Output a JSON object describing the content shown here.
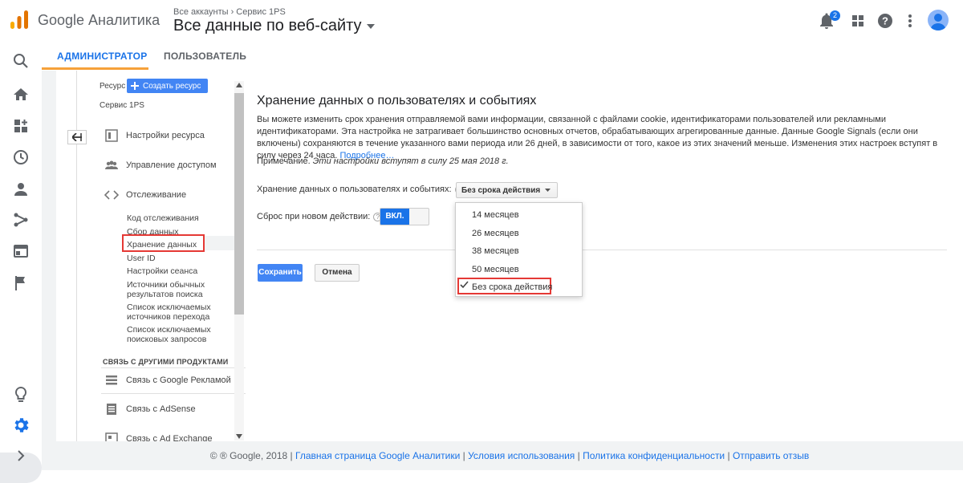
{
  "header": {
    "brand": "Google Аналитика",
    "breadcrumb": "Все аккаунты › Сервис 1PS",
    "view_title": "Все данные по веб-сайту",
    "notification_count": "2",
    "icons": [
      "bell-icon",
      "apps-icon",
      "help-icon",
      "more-vert-icon",
      "avatar"
    ]
  },
  "rail": {
    "icons": [
      "search-icon",
      "home-icon",
      "customize-icon",
      "clock-icon",
      "person-icon",
      "share-icon",
      "window-icon",
      "flag-icon",
      "lightbulb-icon",
      "gear-icon",
      "chevron-right-icon"
    ]
  },
  "tabs": {
    "admin": "АДМИНИСТРАТОР",
    "user": "ПОЛЬЗОВАТЕЛЬ"
  },
  "resource": {
    "label": "Ресурс",
    "create_button": "Создать ресурс",
    "name": "Сервис 1PS",
    "sections": [
      {
        "label": "Настройки ресурса",
        "icon": "settings-page-icon"
      },
      {
        "label": "Управление доступом",
        "icon": "people-icon"
      },
      {
        "label": "Отслеживание",
        "icon": "code-icon"
      }
    ],
    "sub_items": [
      "Код отслеживания",
      "Сбор данных",
      "Хранение данных",
      "User ID",
      "Настройки сеанса",
      "Источники обычных результатов поиска",
      "Список исключаемых источников перехода",
      "Список исключаемых поисковых запросов"
    ],
    "selected_sub_item": "Хранение данных",
    "other_products_header": "СВЯЗЬ С ДРУГИМИ ПРОДУКТАМИ",
    "links": [
      {
        "label": "Связь с Google Рекламой",
        "icon": "ads-link-icon"
      },
      {
        "label": "Связь с AdSense",
        "icon": "adsense-link-icon"
      },
      {
        "label": "Связь с Ad Exchange",
        "icon": "ad-exchange-link-icon"
      }
    ]
  },
  "main": {
    "title": "Хранение данных о пользователях и событиях",
    "description": "Вы можете изменить срок хранения отправляемой вами информации, связанной с файлами cookie, идентификаторами пользователей или рекламными идентификаторами. Эта настройка не затрагивает большинство основных отчетов, обрабатывающих агрегированные данные. Данные Google Signals (если они включены) сохраняются в течение указанного вами периода или 26 дней, в зависимости от того, какое из этих значений меньше. Изменения этих настроек вступят в силу через 24 часа.",
    "learn_more": "Подробнее…",
    "note_label": "Примечание.",
    "note_text": "Эти настройки вступят в силу 25 мая 2018 г.",
    "retention_label": "Хранение данных о пользователях и событиях:",
    "retention_value": "Без срока действия",
    "reset_label": "Сброс при новом действии:",
    "reset_toggle": "ВКЛ.",
    "save": "Сохранить",
    "cancel": "Отмена",
    "dropdown_options": [
      "14 месяцев",
      "26 месяцев",
      "38 месяцев",
      "50 месяцев",
      "Без срока действия"
    ],
    "dropdown_selected": "Без срока действия"
  },
  "footer": {
    "copyright": "© ® Google, 2018",
    "links": [
      "Главная страница Google Аналитики",
      "Условия использования",
      "Политика конфиденциальности",
      "Отправить отзыв"
    ]
  },
  "colors": {
    "accent": "#1a73e8",
    "tab_underline": "#f6a13a",
    "highlight": "#e53935",
    "primary_button": "#4285f4"
  }
}
